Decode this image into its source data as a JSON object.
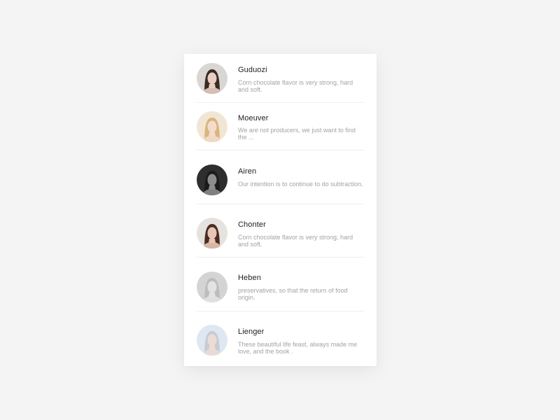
{
  "contacts": [
    {
      "name": "Guduozi",
      "message": "Corn chocolate flavor is very strong, hard and soft.",
      "avatar_icon": "portrait-dark-hair-icon",
      "avatar_colors": {
        "bg": "#d9d6d4",
        "hair": "#3b2a22",
        "skin": "#e8cfc2"
      }
    },
    {
      "name": "Moeuver",
      "message": "We are not producers, we just want to find the ...",
      "avatar_icon": "portrait-blonde-hair-icon",
      "avatar_colors": {
        "bg": "#f1e6d4",
        "hair": "#d9b57e",
        "skin": "#f3dccb"
      }
    },
    {
      "name": "Airen",
      "message": "Our intention is to continue to do subtraction.",
      "avatar_icon": "portrait-monochrome-icon",
      "avatar_colors": {
        "bg": "#2e2e2e",
        "hair": "#1a1a1a",
        "skin": "#8c8c8c"
      }
    },
    {
      "name": "Chonter",
      "message": "Corn chocolate flavor is very strong, hard and soft.",
      "avatar_icon": "portrait-brown-hair-icon",
      "avatar_colors": {
        "bg": "#e6e2de",
        "hair": "#4a2d22",
        "skin": "#e8c6b6"
      }
    },
    {
      "name": "Heben",
      "message": "preservatives, so that the return of food origin.",
      "avatar_icon": "portrait-hat-icon",
      "avatar_colors": {
        "bg": "#d4d4d4",
        "hair": "#bdbdbd",
        "skin": "#e3e3e3"
      }
    },
    {
      "name": "Lienger",
      "message": "These beautiful life feast, always made me love, and the book .",
      "avatar_icon": "portrait-light-hair-icon",
      "avatar_colors": {
        "bg": "#dfe7f3",
        "hair": "#c9cbd2",
        "skin": "#ecdcd6"
      }
    }
  ]
}
